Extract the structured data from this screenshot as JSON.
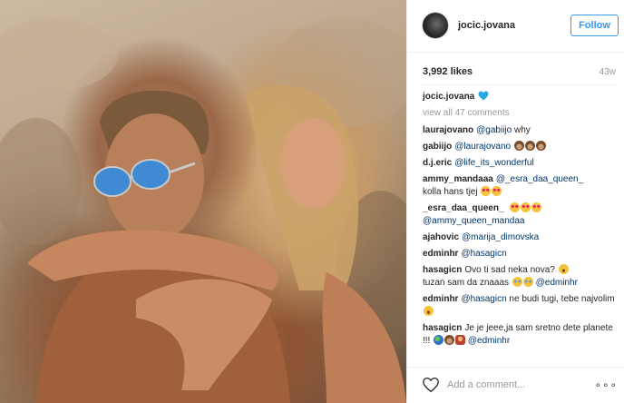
{
  "post": {
    "username": "jocic.jovana",
    "follow_label": "Follow",
    "likes": "3,992 likes",
    "age": "43w",
    "view_all_comments": "view all 47 comments",
    "add_comment_placeholder": "Add a comment...",
    "more_options": "∘∘∘"
  },
  "caption": {
    "user": "jocic.jovana"
  },
  "comments": [
    {
      "user": "laurajovano",
      "mention": "@gabiijo",
      "text": " why"
    },
    {
      "user": "gabiijo",
      "mention": "@laurajovano",
      "text": ""
    },
    {
      "user": "d.j.eric",
      "mention": "@life_its_wonderful",
      "text": ""
    },
    {
      "user": "ammy_mandaaa",
      "mention": "@_esra_daa_queen_",
      "text": "kolla hans tjej"
    },
    {
      "user": "_esra_daa_queen_",
      "mention": "@ammy_queen_mandaa",
      "text": ""
    },
    {
      "user": "ajahovic",
      "mention": "@marija_dimovska",
      "text": ""
    },
    {
      "user": "edminhr",
      "mention": "@hasagicn",
      "text": ""
    },
    {
      "user": "hasagicn",
      "text1": "Ovo ti sad neka nova?",
      "text2": "tuzan sam da znaaas",
      "mention": "@edminhr"
    },
    {
      "user": "edminhr",
      "mention": "@hasagicn",
      "text": " ne budi tugi, tebe najvolim"
    },
    {
      "user": "hasagicn",
      "text1": "Je je jeee,ja sam sretno dete planete !!!",
      "mention": "@edminhr"
    }
  ],
  "icons": {
    "caption_emoji": "blue-heart-icon",
    "like": "heart-outline-icon",
    "avatar": "profile-avatar"
  },
  "colors": {
    "follow_blue": "#3897f0",
    "mention_blue": "#003569",
    "muted_gray": "#999999"
  }
}
